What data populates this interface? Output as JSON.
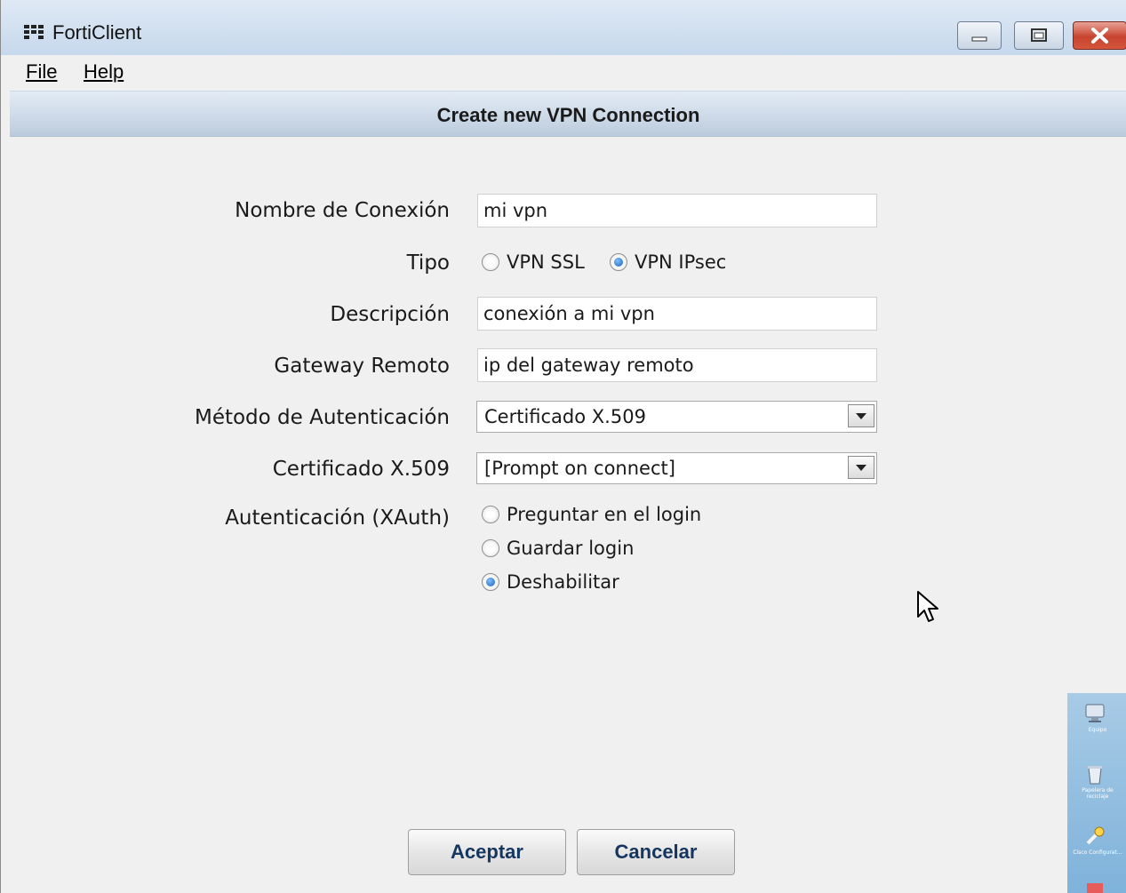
{
  "window": {
    "title": "FortiClient"
  },
  "menu": {
    "file": "File",
    "help": "Help"
  },
  "header": {
    "title": "Create new VPN Connection"
  },
  "form": {
    "connection_name": {
      "label": "Nombre de Conexión",
      "value": "mi vpn"
    },
    "type": {
      "label": "Tipo",
      "options": [
        {
          "label": "VPN SSL",
          "selected": false
        },
        {
          "label": "VPN IPsec",
          "selected": true
        }
      ]
    },
    "description": {
      "label": "Descripción",
      "value": "conexión a mi vpn"
    },
    "remote_gateway": {
      "label": "Gateway Remoto",
      "value": "ip del gateway remoto"
    },
    "auth_method": {
      "label": "Método de Autenticación",
      "value": "Certificado X.509"
    },
    "certificate": {
      "label": "Certificado X.509",
      "value": "[Prompt on connect]"
    },
    "xauth": {
      "label": "Autenticación (XAuth)",
      "options": [
        {
          "label": "Preguntar en el login",
          "selected": false
        },
        {
          "label": "Guardar login",
          "selected": false
        },
        {
          "label": "Deshabilitar",
          "selected": true
        }
      ]
    }
  },
  "buttons": {
    "accept": "Aceptar",
    "cancel": "Cancelar"
  },
  "desktop_icons": [
    {
      "name": "computer-icon",
      "label": "Equipo"
    },
    {
      "name": "recycle-bin-icon",
      "label": "Papelera de reciclaje"
    },
    {
      "name": "settings-tool-icon",
      "label": "Cisco Configurat..."
    }
  ],
  "colors": {
    "accent": "#1c5fb5",
    "close_button": "#c7432f",
    "button_text": "#14365f"
  }
}
